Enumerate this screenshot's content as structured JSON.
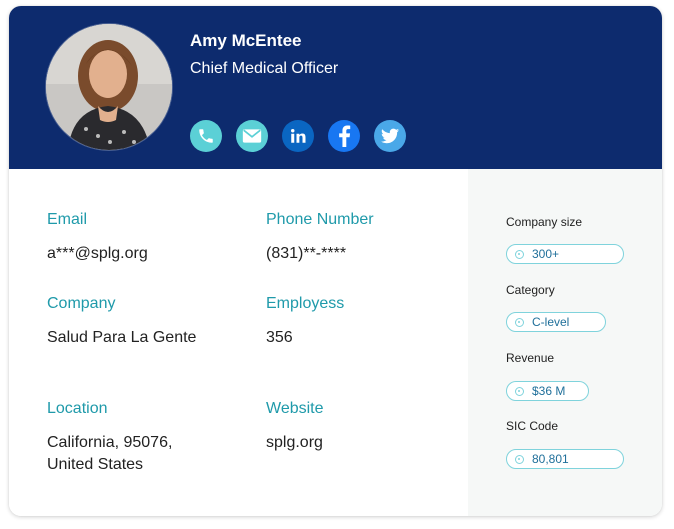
{
  "profile": {
    "name": "Amy McEntee",
    "title": "Chief Medical Officer",
    "socials": [
      {
        "icon": "phone-icon",
        "color": "#5bd0d6"
      },
      {
        "icon": "mail-icon",
        "color": "#5bd0d6"
      },
      {
        "icon": "linkedin-icon",
        "color": "#0a66c2"
      },
      {
        "icon": "facebook-icon",
        "color": "#1877f2"
      },
      {
        "icon": "twitter-icon",
        "color": "#4aa8e8"
      }
    ]
  },
  "details": {
    "email": {
      "label": "Email",
      "value": "a***@splg.org"
    },
    "phone": {
      "label": "Phone Number",
      "value": "(831)**-****"
    },
    "company": {
      "label": "Company",
      "value": "Salud Para La Gente"
    },
    "employees": {
      "label": "Employess",
      "value": "356"
    },
    "location": {
      "label": "Location",
      "value_line1": "California, 95076,",
      "value_line2": "United States"
    },
    "website": {
      "label": "Website",
      "value": "splg.org"
    }
  },
  "attributes": {
    "company_size": {
      "label": "Company size",
      "value": "300+"
    },
    "category": {
      "label": "Category",
      "value": "C-level"
    },
    "revenue": {
      "label": "Revenue",
      "value": "$36 M"
    },
    "sic_code": {
      "label": "SIC Code",
      "value": "80,801"
    }
  },
  "colors": {
    "header": "#0d2b6e",
    "label_teal": "#1f9aaa",
    "pill_border": "#7fd3dc",
    "side_panel": "#f6f8f7"
  }
}
